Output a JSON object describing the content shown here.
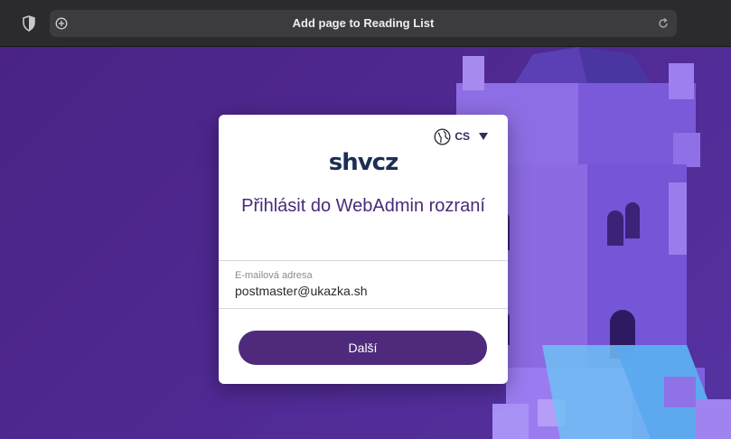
{
  "browser": {
    "url_text": "Add page to Reading List"
  },
  "login": {
    "language_code": "CS",
    "logo_text": "shvcz",
    "title": "Přihlásit do WebAdmin rozraní",
    "email_label": "E-mailová adresa",
    "email_value": "postmaster@ukazka.sh",
    "next_label": "Další"
  },
  "colors": {
    "accent": "#4f2a7c",
    "background": "#532a98",
    "title": "#4a2a7a"
  }
}
